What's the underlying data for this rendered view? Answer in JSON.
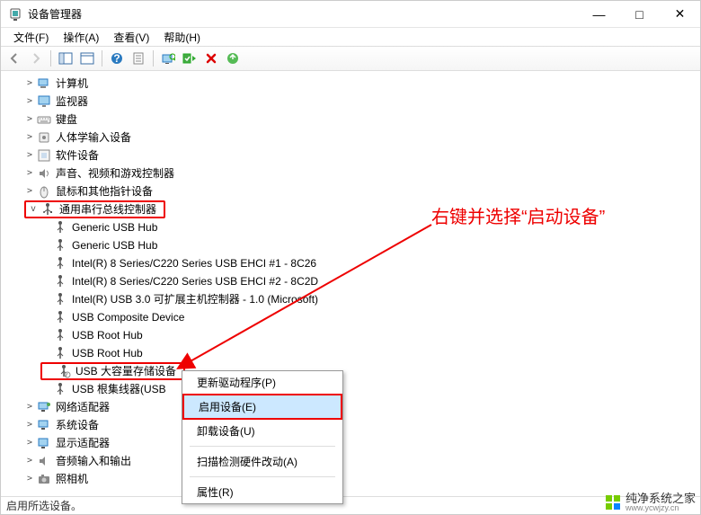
{
  "window": {
    "title": "设备管理器",
    "minimize": "—",
    "maximize": "□",
    "close": "✕"
  },
  "menu": {
    "file": "文件(F)",
    "action": "操作(A)",
    "view": "查看(V)",
    "help": "帮助(H)"
  },
  "statusbar": "启用所选设备。",
  "tree": {
    "n0": "计算机",
    "n1": "监视器",
    "n2": "键盘",
    "n3": "人体学输入设备",
    "n4": "软件设备",
    "n5": "声音、视频和游戏控制器",
    "n6": "鼠标和其他指针设备",
    "n7": "通用串行总线控制器",
    "c0": "Generic USB Hub",
    "c1": "Generic USB Hub",
    "c2": "Intel(R) 8 Series/C220 Series USB EHCI #1 - 8C26",
    "c3": "Intel(R) 8 Series/C220 Series USB EHCI #2 - 8C2D",
    "c4": "Intel(R) USB 3.0 可扩展主机控制器 - 1.0 (Microsoft)",
    "c5": "USB Composite Device",
    "c6": "USB Root Hub",
    "c7": "USB Root Hub",
    "c8": "USB 大容量存储设备",
    "c9": "USB 根集线器(USB",
    "n8": "网络适配器",
    "n9": "系统设备",
    "n10": "显示适配器",
    "n11": "音频输入和输出",
    "n12": "照相机"
  },
  "context_menu": {
    "update_driver": "更新驱动程序(P)",
    "enable_device": "启用设备(E)",
    "uninstall_device": "卸载设备(U)",
    "scan_hardware": "扫描检测硬件改动(A)",
    "properties": "属性(R)"
  },
  "annotation": {
    "hint": "右键并选择“启动设备”"
  },
  "watermark": {
    "text": "纯净系统之家",
    "url": "www.ycwjzy.cn"
  }
}
